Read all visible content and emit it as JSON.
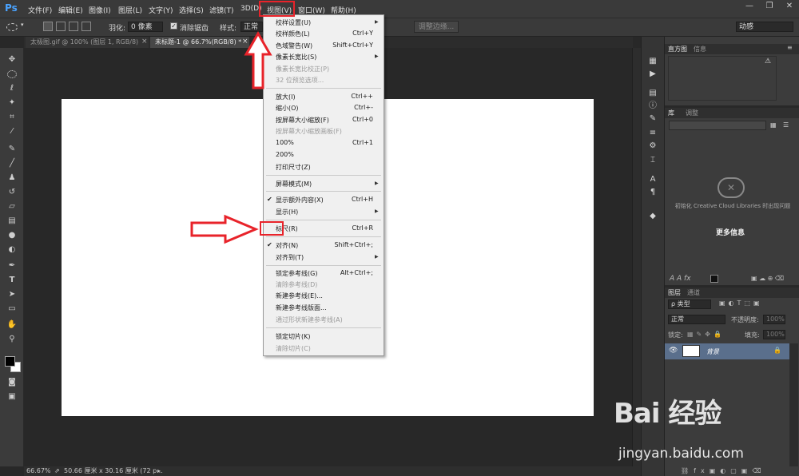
{
  "app": {
    "logo": "Ps"
  },
  "menubar": {
    "items": [
      "文件(F)",
      "编辑(E)",
      "图像(I)",
      "图层(L)",
      "文字(Y)",
      "选择(S)",
      "滤镜(T)",
      "3D(D)",
      "视图(V)",
      "窗口(W)",
      "帮助(H)"
    ]
  },
  "window_controls": {
    "minimize": "—",
    "restore": "❐",
    "close": "✕"
  },
  "options": {
    "feather_label": "羽化:",
    "feather_value": "0 像素",
    "antialias_label": "消除锯齿",
    "style_label": "样式:",
    "style_value": "正常",
    "refine_edge": "调整边缘...",
    "workspace": "动感"
  },
  "tabs": [
    {
      "label": "太极图.gif @ 100% (图层 1, RGB/8)",
      "close": "×"
    },
    {
      "label": "未标题-1 @ 66.7%(RGB/8) *",
      "close": "×"
    }
  ],
  "status": {
    "zoom": "66.67%",
    "size": "50.66 厘米 x 30.16 厘米 (72 p..."
  },
  "view_menu": {
    "items": [
      {
        "label": "校样设置(U)",
        "shortcut": "",
        "disabled": false,
        "submenu": true
      },
      {
        "label": "校样颜色(L)",
        "shortcut": "Ctrl+Y",
        "disabled": false
      },
      {
        "label": "色域警告(W)",
        "shortcut": "Shift+Ctrl+Y",
        "disabled": false
      },
      {
        "label": "像素长宽比(S)",
        "shortcut": "",
        "disabled": false,
        "submenu": true
      },
      {
        "label": "像素长宽比校正(P)",
        "shortcut": "",
        "disabled": true
      },
      {
        "label": "32 位预览选项...",
        "shortcut": "",
        "disabled": true
      },
      {
        "label": "放大(I)",
        "shortcut": "Ctrl++",
        "disabled": false
      },
      {
        "label": "缩小(O)",
        "shortcut": "Ctrl+-",
        "disabled": false
      },
      {
        "label": "按屏幕大小缩放(F)",
        "shortcut": "Ctrl+0",
        "disabled": false
      },
      {
        "label": "按屏幕大小缩放画板(F)",
        "shortcut": "",
        "disabled": true
      },
      {
        "label": "100%",
        "shortcut": "Ctrl+1",
        "disabled": false
      },
      {
        "label": "200%",
        "shortcut": "",
        "disabled": false
      },
      {
        "label": "打印尺寸(Z)",
        "shortcut": "",
        "disabled": false
      },
      {
        "label": "屏幕模式(M)",
        "shortcut": "",
        "disabled": false,
        "submenu": true
      },
      {
        "label": "显示额外内容(X)",
        "shortcut": "Ctrl+H",
        "disabled": false,
        "checked": true
      },
      {
        "label": "显示(H)",
        "shortcut": "",
        "disabled": false,
        "submenu": true
      },
      {
        "label": "标尺(R)",
        "shortcut": "Ctrl+R",
        "disabled": false
      },
      {
        "label": "对齐(N)",
        "shortcut": "Shift+Ctrl+;",
        "disabled": false,
        "checked": true
      },
      {
        "label": "对齐到(T)",
        "shortcut": "",
        "disabled": false,
        "submenu": true
      },
      {
        "label": "锁定参考线(G)",
        "shortcut": "Alt+Ctrl+;",
        "disabled": false
      },
      {
        "label": "清除参考线(D)",
        "shortcut": "",
        "disabled": true
      },
      {
        "label": "新建参考线(E)...",
        "shortcut": "",
        "disabled": false
      },
      {
        "label": "新建参考线版面...",
        "shortcut": "",
        "disabled": false
      },
      {
        "label": "通过形状新建参考线(A)",
        "shortcut": "",
        "disabled": true
      },
      {
        "label": "锁定切片(K)",
        "shortcut": "",
        "disabled": false
      },
      {
        "label": "清除切片(C)",
        "shortcut": "",
        "disabled": true
      }
    ]
  },
  "panels": {
    "histogram_tab": "直方图",
    "info_tab": "信息",
    "library_tab": "库",
    "adjust_tab": "调整",
    "cc_message": "初始化 Creative Cloud Libraries 时出现问题",
    "more_info": "更多信息",
    "layers_tab": "图层",
    "channels_tab": "通道",
    "kind_label": "ρ 类型",
    "blend_mode": "正常",
    "opacity_label": "不透明度:",
    "opacity_value": "100%",
    "lock_label": "锁定:",
    "fill_label": "填充:",
    "fill_value": "100%",
    "layer_name": "背景"
  },
  "watermark": {
    "logo": "Bai 经验",
    "url": "jingyan.baidu.com"
  },
  "colors": {
    "annotation_red": "#e8232a",
    "ps_blue": "#4aa3ff",
    "layer_selected": "#5a6f8c"
  }
}
